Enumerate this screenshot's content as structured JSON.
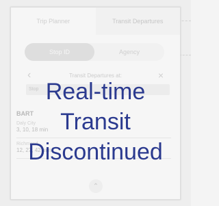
{
  "tabs": [
    {
      "label": "Trip Planner"
    },
    {
      "label": "Transit Departures"
    }
  ],
  "mode_toggle": {
    "options": [
      {
        "label": "Stop ID"
      },
      {
        "label": "Agency"
      }
    ],
    "selected": "Stop ID"
  },
  "header": {
    "title": "Transit Departures at:"
  },
  "stop_input": {
    "value": "Stop"
  },
  "agency": "BART",
  "departures": [
    {
      "destination": "Daly City",
      "times": "3, 10, 18 min"
    },
    {
      "destination": "Richmond",
      "times": "12, 27, 42 min"
    }
  ],
  "overlay": {
    "line1": "Real-time",
    "line2": "Transit",
    "line3": "Discontinued",
    "color": "#2b3a8f"
  },
  "icons": {
    "back": "chevron-left-icon",
    "close": "close-icon",
    "collapse": "chevron-up-icon"
  }
}
